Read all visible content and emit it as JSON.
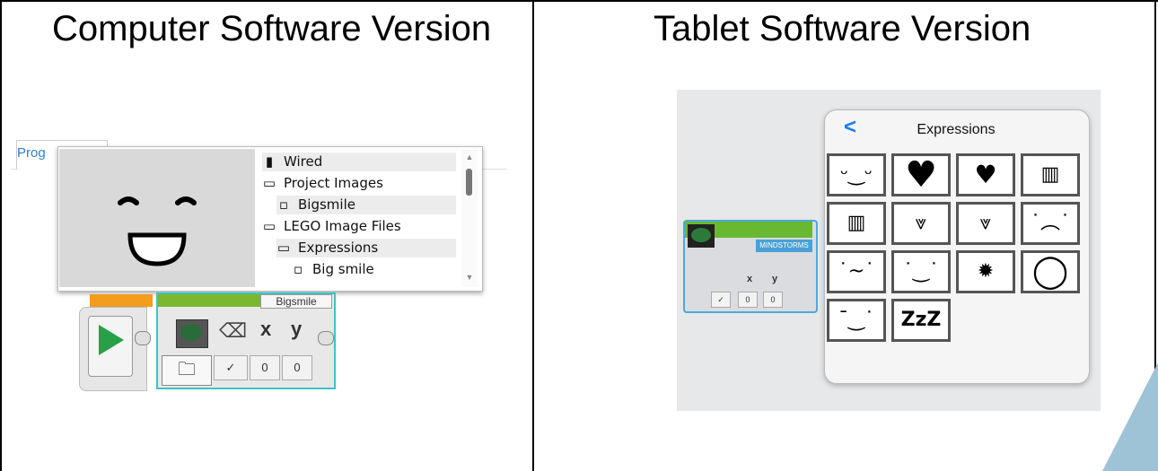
{
  "headings": {
    "left": "Computer Software Version",
    "right": "Tablet Software Version"
  },
  "computer": {
    "tab_label": "Prog",
    "file_items": [
      {
        "label": "Wired",
        "icon": "brick-icon",
        "selected": true
      },
      {
        "label": "Project Images",
        "icon": "folder-icon",
        "selected": false
      },
      {
        "label": "Bigsmile",
        "icon": "file-icon",
        "selected": true
      },
      {
        "label": "LEGO Image Files",
        "icon": "folder-icon",
        "selected": false
      },
      {
        "label": "Expressions",
        "icon": "folder-icon",
        "selected": true
      },
      {
        "label": "Big smile",
        "icon": "file-icon",
        "selected": false
      }
    ],
    "block_name": "Bigsmile",
    "param_x_label": "x",
    "param_y_label": "y",
    "x_value": "0",
    "y_value": "0",
    "check_symbol": "✓"
  },
  "tablet": {
    "panel_title": "Expressions",
    "back_symbol": "<",
    "block_tag": "MINDSTORMS",
    "param_x_label": "x",
    "param_y_label": "y",
    "x_value": "0",
    "y_value": "0",
    "check_symbol": "✓",
    "expressions": [
      {
        "icon": "big-smile-icon"
      },
      {
        "icon": "big-heart-icon"
      },
      {
        "icon": "small-heart-icon"
      },
      {
        "icon": "mouth-icon"
      },
      {
        "icon": "teeth-icon"
      },
      {
        "icon": "fangs-icon"
      },
      {
        "icon": "fangs-small-icon"
      },
      {
        "icon": "sad-face-icon"
      },
      {
        "icon": "sick-face-icon"
      },
      {
        "icon": "smile-face-icon"
      },
      {
        "icon": "angry-scribble-icon"
      },
      {
        "icon": "speech-bubble-icon"
      },
      {
        "icon": "wink-face-icon"
      },
      {
        "icon": "sleep-zzz-icon",
        "text": "ZzZ"
      }
    ]
  }
}
